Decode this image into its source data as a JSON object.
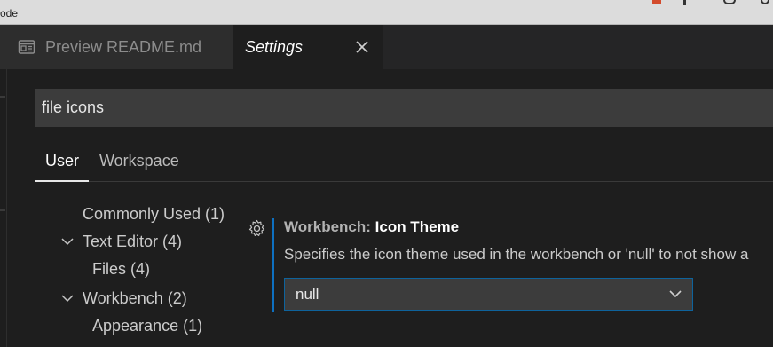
{
  "window": {
    "title": "ode"
  },
  "tabs": [
    {
      "label": "Preview README.md",
      "icon": "preview-icon"
    },
    {
      "label": "Settings",
      "icon": "close-icon"
    }
  ],
  "search": {
    "value": "file icons"
  },
  "scopes": {
    "user": "User",
    "workspace": "Workspace"
  },
  "toc": [
    {
      "label": "Commonly Used (1)"
    },
    {
      "label": "Text Editor (4)",
      "expandable": true
    },
    {
      "label": "Files (4)"
    },
    {
      "label": "Workbench (2)",
      "expandable": true
    },
    {
      "label": "Appearance (1)"
    }
  ],
  "setting": {
    "category": "Workbench: ",
    "name": "Icon Theme",
    "description": "Specifies the icon theme used in the workbench or 'null' to not show a",
    "value": "null"
  },
  "colors": {
    "accent": "#0e70c0",
    "background": "#1e1e1e",
    "input": "#3c3c3c"
  }
}
